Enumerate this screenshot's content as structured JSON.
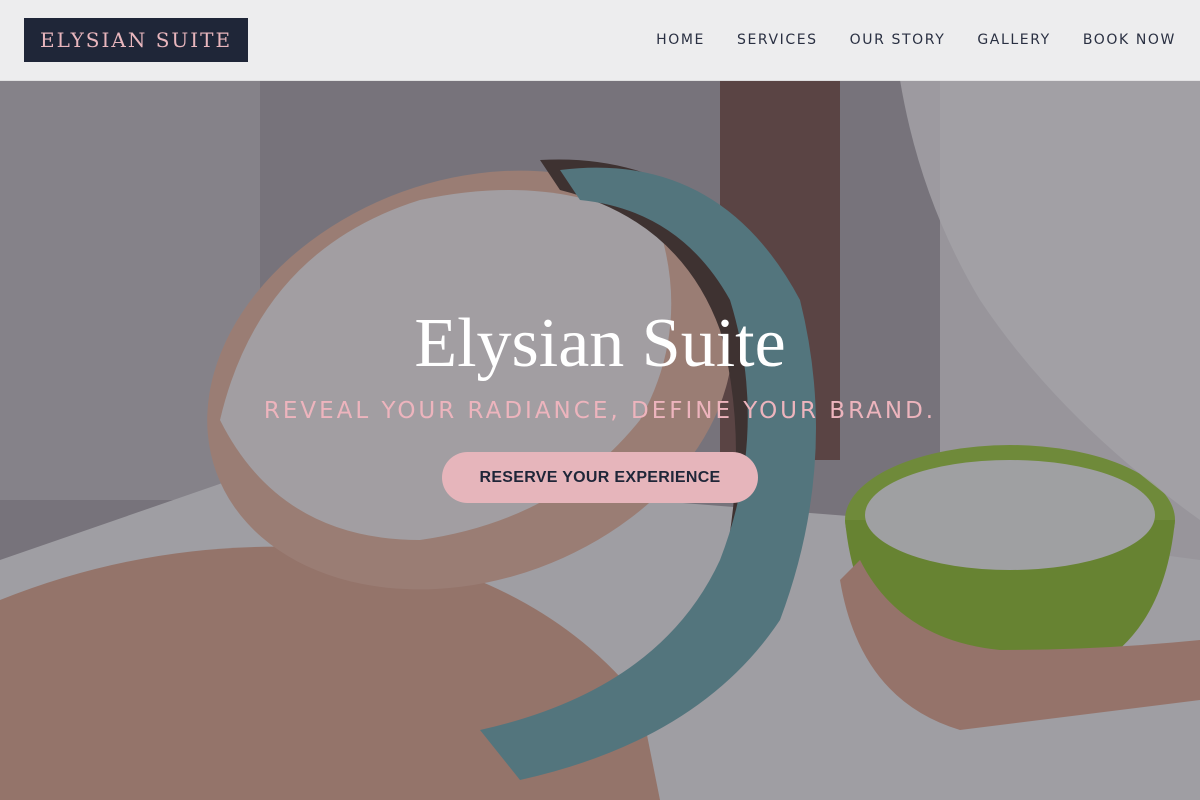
{
  "brand": {
    "logo_text": "ELYSIAN SUITE"
  },
  "nav": {
    "items": [
      {
        "label": "HOME"
      },
      {
        "label": "SERVICES"
      },
      {
        "label": "OUR STORY"
      },
      {
        "label": "GALLERY"
      },
      {
        "label": "BOOK NOW"
      }
    ]
  },
  "hero": {
    "title": "Elysian Suite",
    "tagline": "REVEAL YOUR RADIANCE, DEFINE YOUR BRAND.",
    "cta_label": "RESERVE YOUR EXPERIENCE",
    "background_image": "facial-spa-treatment-photo"
  },
  "colors": {
    "navy": "#1f2638",
    "blush": "#e6b5bb",
    "tagline_pink": "#edb4bd",
    "header_bg": "#f5f5f6"
  }
}
